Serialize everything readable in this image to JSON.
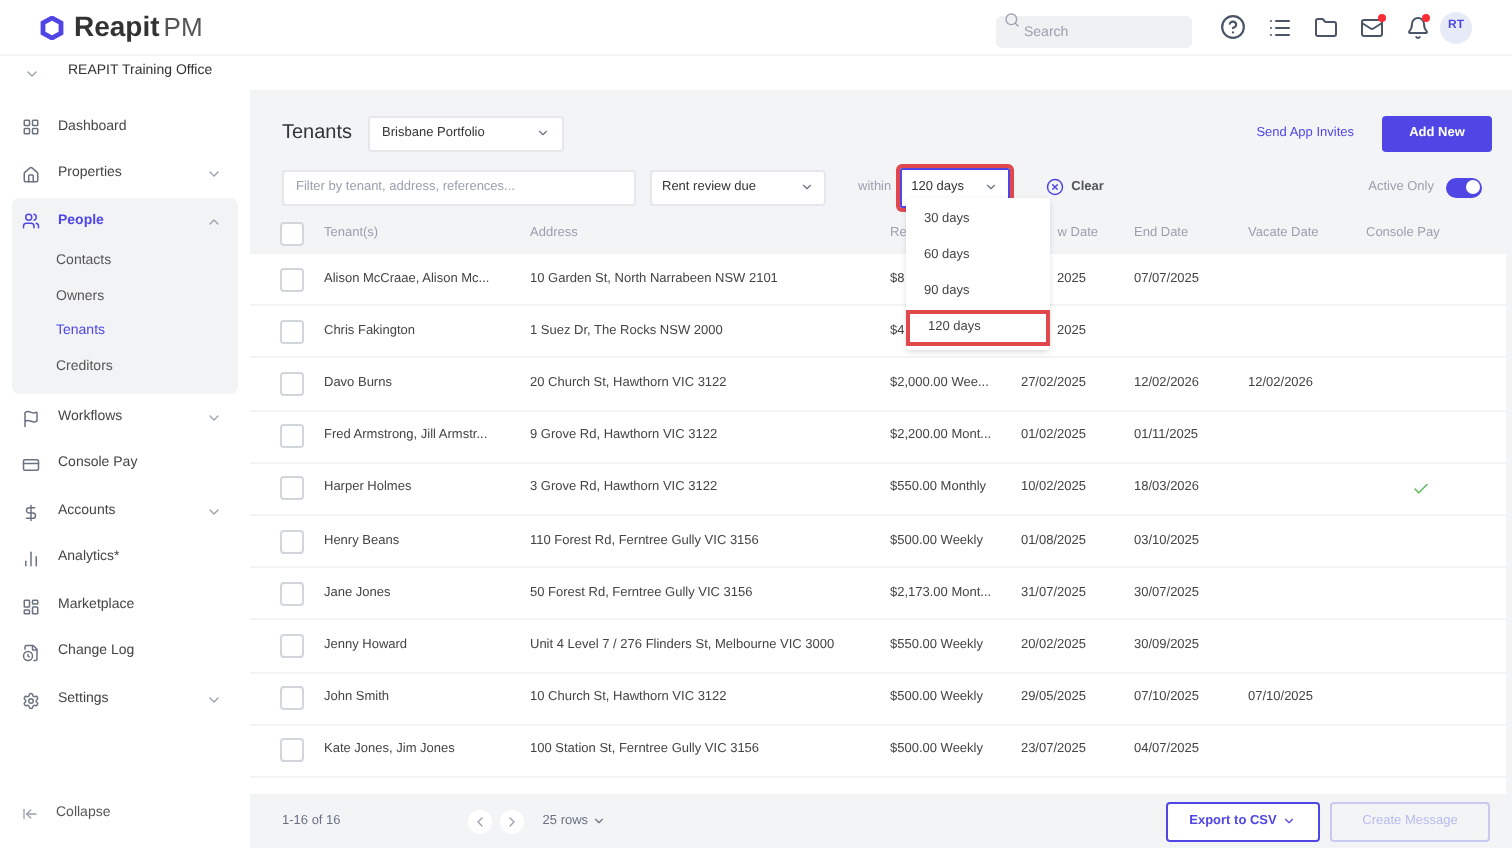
{
  "brand": {
    "name": "Reapit",
    "suffix": "PM"
  },
  "search": {
    "placeholder": "Search"
  },
  "avatar": "RT",
  "notifications": {
    "mail_dot": true,
    "bell_dot": true
  },
  "office": "REAPIT Training Office",
  "sidebar": {
    "items": [
      {
        "label": "Dashboard"
      },
      {
        "label": "Properties",
        "expanded": false
      },
      {
        "label": "People",
        "expanded": true,
        "children": [
          {
            "label": "Contacts",
            "selected": false
          },
          {
            "label": "Owners",
            "selected": false
          },
          {
            "label": "Tenants",
            "selected": true
          },
          {
            "label": "Creditors",
            "selected": false
          }
        ]
      },
      {
        "label": "Workflows",
        "expanded": false
      },
      {
        "label": "Console Pay"
      },
      {
        "label": "Accounts",
        "expanded": false
      },
      {
        "label": "Analytics*"
      },
      {
        "label": "Marketplace"
      },
      {
        "label": "Change Log"
      },
      {
        "label": "Settings",
        "expanded": false
      }
    ],
    "collapse": "Collapse"
  },
  "page": {
    "title": "Tenants",
    "portfolio": "Brisbane Portfolio",
    "send_invites": "Send App Invites",
    "add_new": "Add New"
  },
  "filters": {
    "placeholder": "Filter by tenant, address, references...",
    "type": "Rent review due",
    "within_label": "within",
    "within_value": "120 days",
    "clear": "Clear",
    "active_only_label": "Active Only",
    "active_only": true
  },
  "dropdown": {
    "options": [
      {
        "label": "30 days",
        "selected": false
      },
      {
        "label": "60 days",
        "selected": false
      },
      {
        "label": "90 days",
        "selected": false
      },
      {
        "label": "120 days",
        "selected": true
      }
    ]
  },
  "table": {
    "select_all": false,
    "columns": [
      "Tenant(s)",
      "Address",
      "Re",
      "w Date",
      "End Date",
      "Vacate Date",
      "Console Pay"
    ],
    "rows": [
      {
        "checked": false,
        "tenant": "Alison McCraae, Alison Mc...",
        "address": "10 Garden St, North Narrabeen NSW 2101",
        "rent": "$8",
        "review": "2025",
        "end": "07/07/2025",
        "vacate": "",
        "console_pay": false
      },
      {
        "checked": false,
        "tenant": "Chris Fakington",
        "address": "1 Suez Dr, The Rocks NSW 2000",
        "rent": "$4",
        "review": "2025",
        "end": "",
        "vacate": "",
        "console_pay": false
      },
      {
        "checked": false,
        "tenant": "Davo Burns",
        "address": "20 Church St, Hawthorn VIC 3122",
        "rent": "$2,000.00 Wee...",
        "review": "27/02/2025",
        "end": "12/02/2026",
        "vacate": "12/02/2026",
        "console_pay": false
      },
      {
        "checked": false,
        "tenant": "Fred Armstrong, Jill Armstr...",
        "address": "9 Grove Rd, Hawthorn VIC 3122",
        "rent": "$2,200.00 Mont...",
        "review": "01/02/2025",
        "end": "01/11/2025",
        "vacate": "",
        "console_pay": false
      },
      {
        "checked": false,
        "tenant": "Harper Holmes",
        "address": "3 Grove Rd, Hawthorn VIC 3122",
        "rent": "$550.00 Monthly",
        "review": "10/02/2025",
        "end": "18/03/2026",
        "vacate": "",
        "console_pay": true
      },
      {
        "checked": false,
        "tenant": "Henry Beans",
        "address": "110 Forest Rd, Ferntree Gully VIC 3156",
        "rent": "$500.00 Weekly",
        "review": "01/08/2025",
        "end": "03/10/2025",
        "vacate": "",
        "console_pay": false
      },
      {
        "checked": false,
        "tenant": "Jane Jones",
        "address": "50 Forest Rd, Ferntree Gully VIC 3156",
        "rent": "$2,173.00 Mont...",
        "review": "31/07/2025",
        "end": "30/07/2025",
        "vacate": "",
        "console_pay": false
      },
      {
        "checked": false,
        "tenant": "Jenny Howard",
        "address": "Unit 4 Level 7 / 276 Flinders St, Melbourne VIC 3000",
        "rent": "$550.00 Weekly",
        "review": "20/02/2025",
        "end": "30/09/2025",
        "vacate": "",
        "console_pay": false
      },
      {
        "checked": false,
        "tenant": "John Smith",
        "address": "10 Church St, Hawthorn VIC 3122",
        "rent": "$500.00 Weekly",
        "review": "29/05/2025",
        "end": "07/10/2025",
        "vacate": "07/10/2025",
        "console_pay": false
      },
      {
        "checked": false,
        "tenant": "Kate Jones, Jim Jones",
        "address": "100 Station St, Ferntree Gully VIC 3156",
        "rent": "$500.00 Weekly",
        "review": "23/07/2025",
        "end": "04/07/2025",
        "vacate": "",
        "console_pay": false
      }
    ]
  },
  "footer": {
    "count": "1-16 of 16",
    "rows": "25 rows",
    "export": "Export to CSV",
    "create_message": "Create Message",
    "create_disabled": true
  }
}
